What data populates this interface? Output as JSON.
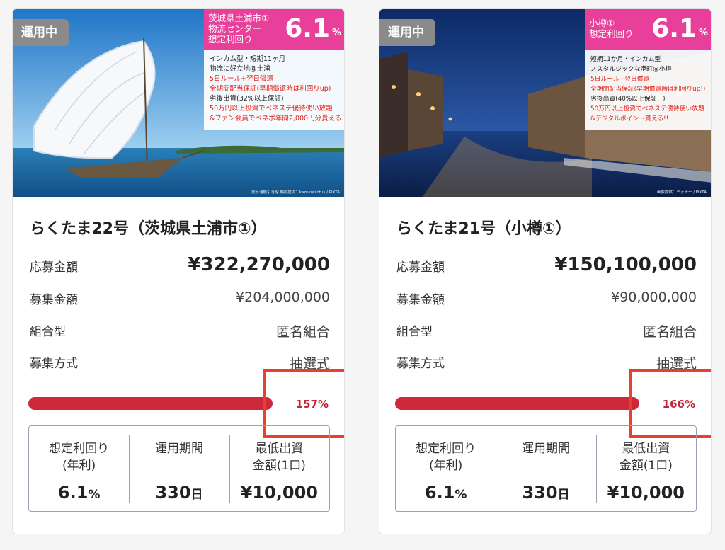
{
  "colors": {
    "accent": "#e8409a",
    "progress": "#d0283b",
    "highlight": "#e8402e"
  },
  "cards": [
    {
      "status": "運用中",
      "promo": {
        "name": "茨城県土浦市①\n物流センター\n想定利回り",
        "rate": "6.1",
        "unit": "%",
        "lines": [
          "インカム型・短期11ヶ月",
          "物流に好立地@土浦",
          "5日ルール+翌日償還",
          "全期間配当保証(早期償還時は利回りup)",
          "劣後出資(32%以上保証)",
          "50万円以上投資でベネステ優待使い放題",
          "&ファン会員でベネポ年間2,000円分貰える"
        ]
      },
      "credit": "霞ヶ浦帆引き船 撮影提供：kazukurilotus / PIXTA",
      "title": "らくたま22号（茨城県土浦市①）",
      "rows": {
        "applied_label": "応募金額",
        "applied_value": "¥322,270,000",
        "target_label": "募集金額",
        "target_value": "¥204,000,000",
        "type_label": "組合型",
        "type_value": "匿名組合",
        "method_label": "募集方式",
        "method_value": "抽選式"
      },
      "progress": {
        "percent": 157,
        "label": "157%"
      },
      "stats": {
        "yield_label": "想定利回り\n(年利)",
        "yield_value": "6.1",
        "yield_unit": "%",
        "period_label": "運用期間",
        "period_value": "330",
        "period_unit": "日",
        "min_label": "最低出資\n金額(1口)",
        "min_value": "¥10,000"
      }
    },
    {
      "status": "運用中",
      "promo": {
        "name": "小樽①\n想定利回り",
        "rate": "6.1",
        "unit": "%",
        "lines": [
          "短期11か月・インカム型",
          "ノスタルジックな港町@小樽",
          "5日ルール+翌日償還",
          "全期間配当保証(早期償還時は利回りup!)",
          "劣後出資(40%以上保証！)",
          "50万円以上投資でベネステ優待使い放題",
          "&デジタルポイント貰える!!"
        ]
      },
      "credit": "画像提供：モッチー / PIXTA",
      "title": "らくたま21号（小樽①）",
      "rows": {
        "applied_label": "応募金額",
        "applied_value": "¥150,100,000",
        "target_label": "募集金額",
        "target_value": "¥90,000,000",
        "type_label": "組合型",
        "type_value": "匿名組合",
        "method_label": "募集方式",
        "method_value": "抽選式"
      },
      "progress": {
        "percent": 166,
        "label": "166%"
      },
      "stats": {
        "yield_label": "想定利回り\n(年利)",
        "yield_value": "6.1",
        "yield_unit": "%",
        "period_label": "運用期間",
        "period_value": "330",
        "period_unit": "日",
        "min_label": "最低出資\n金額(1口)",
        "min_value": "¥10,000"
      }
    }
  ]
}
